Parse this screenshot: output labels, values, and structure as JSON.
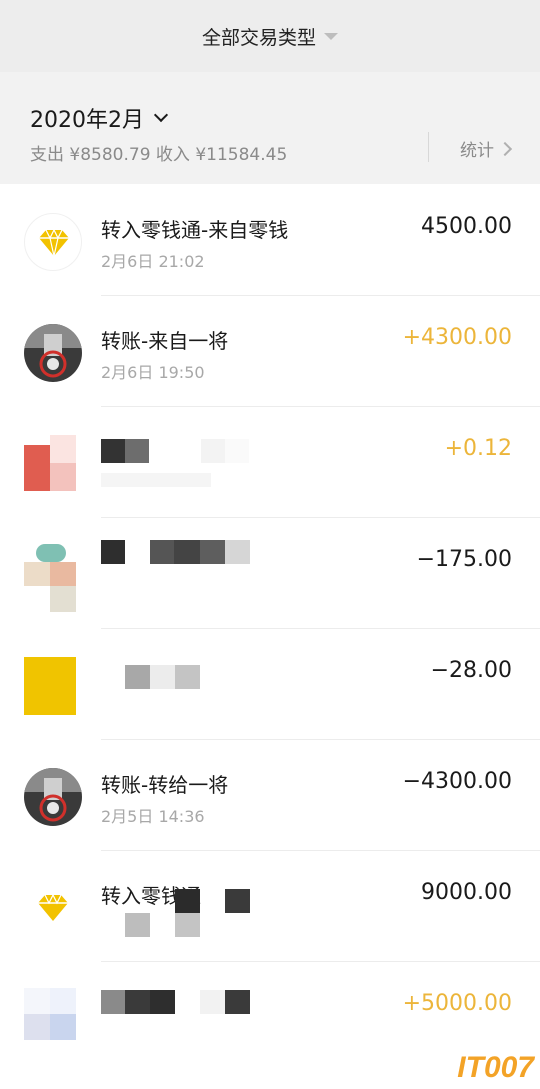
{
  "header": {
    "filter_label": "全部交易类型"
  },
  "month_bar": {
    "month": "2020年2月",
    "summary": "支出 ¥8580.79 收入 ¥11584.45",
    "stats_label": "统计"
  },
  "transactions": [
    {
      "title": "转入零钱通-来自零钱",
      "time": "2月6日 21:02",
      "amount": "4500.00",
      "kind": "neutral",
      "icon": "diamond-icon"
    },
    {
      "title": "转账-来自一将",
      "time": "2月6日 19:50",
      "amount": "+4300.00",
      "kind": "income",
      "icon": "user-avatar"
    },
    {
      "title": "",
      "time": "",
      "amount": "+0.12",
      "kind": "income",
      "icon": "blurred-avatar"
    },
    {
      "title": "",
      "time": "",
      "amount": "−175.00",
      "kind": "expense",
      "icon": "blurred-avatar"
    },
    {
      "title": "",
      "time": "",
      "amount": "−28.00",
      "kind": "expense",
      "icon": "blurred-avatar"
    },
    {
      "title": "转账-转给一将",
      "time": "2月5日 14:36",
      "amount": "−4300.00",
      "kind": "expense",
      "icon": "user-avatar"
    },
    {
      "title": "转入零钱通",
      "time": "",
      "amount": "9000.00",
      "kind": "neutral",
      "icon": "diamond-icon"
    },
    {
      "title": "",
      "time": "",
      "amount": "+5000.00",
      "kind": "income",
      "icon": "blurred-avatar"
    }
  ],
  "watermark": "IT007",
  "colors": {
    "income": "#ecb53a",
    "expense": "#1a1a1a",
    "diamond": "#f2c200"
  }
}
